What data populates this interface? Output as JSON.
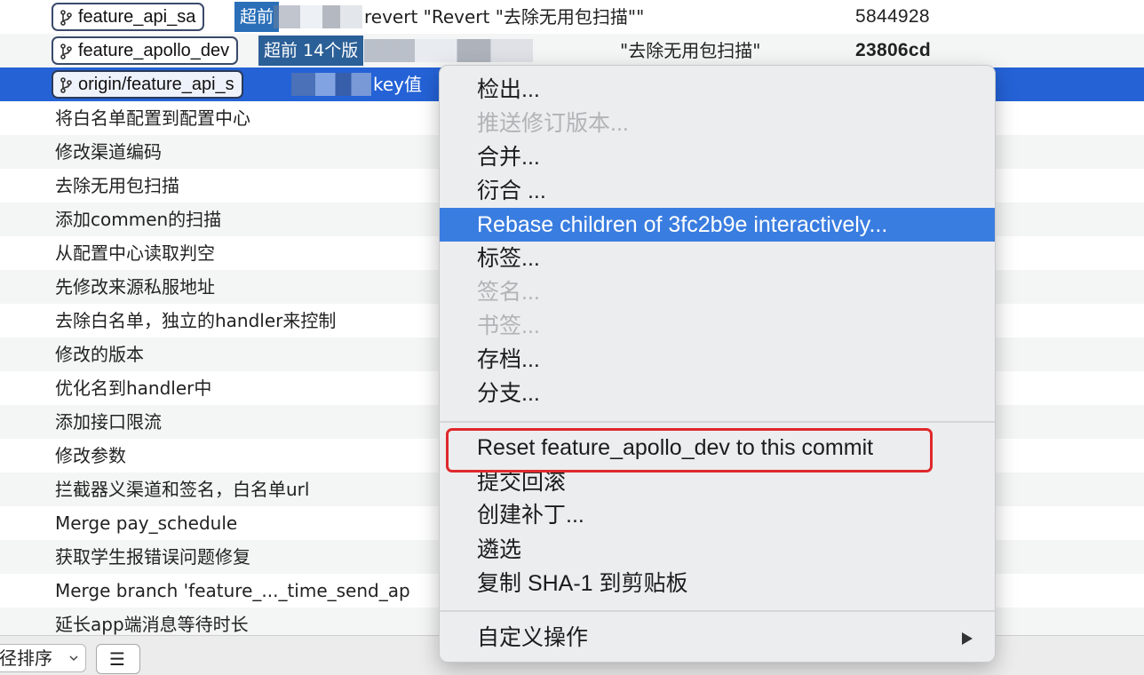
{
  "commit_rows": [
    {
      "branch": "feature_api_sa",
      "tag": "超前",
      "message": "revert \"Revert \"去除无用包扫描\"\"",
      "sha": "5844928",
      "bold_sha": false
    },
    {
      "branch": "feature_apollo_dev",
      "tag": "超前 14个版",
      "message": "\"去除无用包扫描\"",
      "sha": "23806cd",
      "bold_sha": true
    },
    {
      "branch": "origin/feature_api_s",
      "tag": "",
      "message": "key值",
      "sha": "",
      "bold_sha": false
    },
    {
      "message": "将白名单配置到配置中心"
    },
    {
      "message": "修改渠道编码"
    },
    {
      "message": "去除无用包扫描"
    },
    {
      "message": "添加commen的扫描"
    },
    {
      "message": "从配置中心读取判空"
    },
    {
      "message": "先修改来源私服地址"
    },
    {
      "message": "去除白名单，独立的handler来控制"
    },
    {
      "message": "修改的版本"
    },
    {
      "message": "优化名到handler中"
    },
    {
      "message": "添加接口限流"
    },
    {
      "message": "修改参数"
    },
    {
      "message": "拦截器义渠道和签名，白名单url"
    },
    {
      "message": "Merge pay_schedule"
    },
    {
      "message": "获取学生报错误问题修复"
    },
    {
      "message": "Merge branch 'feature_..._time_send_ap"
    },
    {
      "message": "延长app端消息等待时长"
    }
  ],
  "bottom_bar": {
    "sort_label": "径排序",
    "list_glyph": "☰"
  },
  "context_menu": {
    "items": [
      {
        "label": "检出...",
        "disabled": false
      },
      {
        "label": "推送修订版本...",
        "disabled": true
      },
      {
        "label": "合并...",
        "disabled": false
      },
      {
        "label": "衍合 ...",
        "disabled": false
      },
      {
        "label": "Rebase children of 3fc2b9e interactively...",
        "disabled": false,
        "highlighted": true
      },
      {
        "label": "标签...",
        "disabled": false
      },
      {
        "label": "签名...",
        "disabled": true
      },
      {
        "label": "书签...",
        "disabled": true
      },
      {
        "label": "存档...",
        "disabled": false
      },
      {
        "label": "分支...",
        "disabled": false
      },
      {
        "label": "Reset feature_apollo_dev to this commit",
        "disabled": false
      },
      {
        "label": "提交回滚",
        "disabled": false
      },
      {
        "label": "创建补丁...",
        "disabled": false
      },
      {
        "label": "遴选",
        "disabled": false
      },
      {
        "label": "复制 SHA-1 到剪贴板",
        "disabled": false
      },
      {
        "label": "自定义操作",
        "disabled": false,
        "has_submenu": true
      }
    ]
  },
  "colors": {
    "selection": "#2462d6",
    "menu_highlight": "#3a7de0",
    "annotation_red": "#e0282b",
    "tag_blue": "#2a6fb8"
  }
}
